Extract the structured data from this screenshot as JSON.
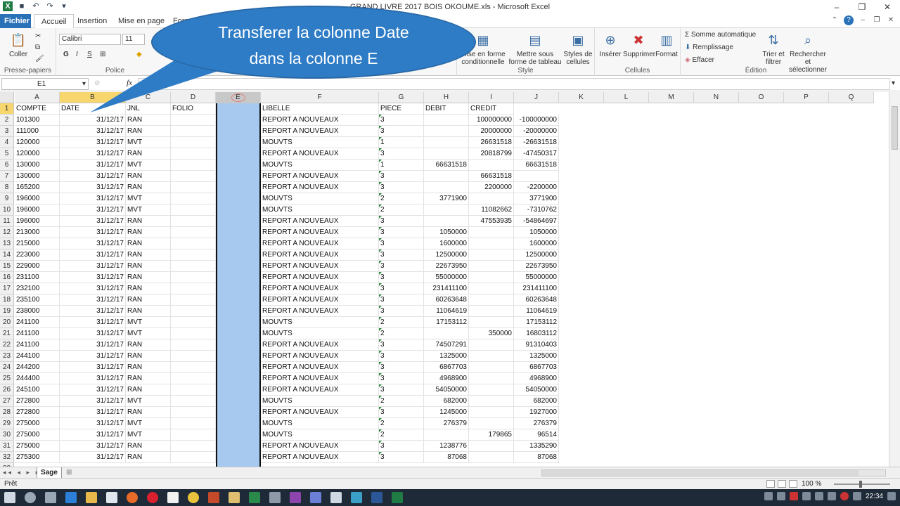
{
  "window": {
    "title": "GRAND LIVRE 2017 BOIS OKOUME.xls  -  Microsoft Excel"
  },
  "tabs": {
    "file": "Fichier",
    "home": "Accueil",
    "insert": "Insertion",
    "page_layout": "Mise en page",
    "formulas": "Form"
  },
  "ribbon": {
    "clipboard": {
      "paste": "Coller",
      "group": "Presse-papiers"
    },
    "font": {
      "name": "Calibri",
      "size": "11",
      "group": "Police"
    },
    "styles": {
      "cond": "Mise en forme conditionnelle",
      "table": "Mettre sous forme de tableau",
      "cell_styles": "Styles de cellules",
      "group": "Style"
    },
    "cells": {
      "insert": "Insérer",
      "delete": "Supprimer",
      "format": "Format",
      "group": "Cellules"
    },
    "editing": {
      "autosum": "Somme automatique",
      "fill": "Remplissage",
      "clear": "Effacer",
      "sort": "Trier et filtrer",
      "find": "Rechercher et sélectionner",
      "group": "Édition"
    }
  },
  "callout": {
    "line1": "Transferer la colonne Date",
    "line2": "dans la colonne E"
  },
  "formula_bar": {
    "name_box": "E1",
    "fx": "fx",
    "formula": ""
  },
  "grid": {
    "columns": [
      "A",
      "B",
      "C",
      "D",
      "E",
      "F",
      "G",
      "H",
      "I",
      "J",
      "K",
      "L",
      "M",
      "N",
      "O",
      "P",
      "Q"
    ],
    "headers": {
      "A": "COMPTE",
      "B": "DATE",
      "C": "JNL",
      "D": "FOLIO",
      "E": "",
      "F": "LIBELLE",
      "G": "PIECE",
      "H": "DEBIT",
      "I": "CREDIT",
      "J": ""
    },
    "rows": [
      [
        "101300",
        "31/12/17",
        "RAN",
        "REPORT A NOUVEAUX",
        "3",
        "",
        "100000000",
        "-100000000"
      ],
      [
        "111000",
        "31/12/17",
        "RAN",
        "REPORT A NOUVEAUX",
        "3",
        "",
        "20000000",
        "-20000000"
      ],
      [
        "120000",
        "31/12/17",
        "MVT",
        "MOUVTS",
        "1",
        "",
        "26631518",
        "-26631518"
      ],
      [
        "120000",
        "31/12/17",
        "RAN",
        "REPORT A NOUVEAUX",
        "3",
        "",
        "20818799",
        "-47450317"
      ],
      [
        "130000",
        "31/12/17",
        "MVT",
        "MOUVTS",
        "1",
        "66631518",
        "",
        "66631518"
      ],
      [
        "130000",
        "31/12/17",
        "RAN",
        "REPORT A NOUVEAUX",
        "3",
        "",
        "66631518",
        ""
      ],
      [
        "165200",
        "31/12/17",
        "RAN",
        "REPORT A NOUVEAUX",
        "3",
        "",
        "2200000",
        "-2200000"
      ],
      [
        "196000",
        "31/12/17",
        "MVT",
        "MOUVTS",
        "2",
        "3771900",
        "",
        "3771900"
      ],
      [
        "196000",
        "31/12/17",
        "MVT",
        "MOUVTS",
        "2",
        "",
        "11082662",
        "-7310762"
      ],
      [
        "196000",
        "31/12/17",
        "RAN",
        "REPORT A NOUVEAUX",
        "3",
        "",
        "47553935",
        "-54864697"
      ],
      [
        "213000",
        "31/12/17",
        "RAN",
        "REPORT A NOUVEAUX",
        "3",
        "1050000",
        "",
        "1050000"
      ],
      [
        "215000",
        "31/12/17",
        "RAN",
        "REPORT A NOUVEAUX",
        "3",
        "1600000",
        "",
        "1600000"
      ],
      [
        "223000",
        "31/12/17",
        "RAN",
        "REPORT A NOUVEAUX",
        "3",
        "12500000",
        "",
        "12500000"
      ],
      [
        "229000",
        "31/12/17",
        "RAN",
        "REPORT A NOUVEAUX",
        "3",
        "22673950",
        "",
        "22673950"
      ],
      [
        "231100",
        "31/12/17",
        "RAN",
        "REPORT A NOUVEAUX",
        "3",
        "55000000",
        "",
        "55000000"
      ],
      [
        "232100",
        "31/12/17",
        "RAN",
        "REPORT A NOUVEAUX",
        "3",
        "231411100",
        "",
        "231411100"
      ],
      [
        "235100",
        "31/12/17",
        "RAN",
        "REPORT A NOUVEAUX",
        "3",
        "60263648",
        "",
        "60263648"
      ],
      [
        "238000",
        "31/12/17",
        "RAN",
        "REPORT A NOUVEAUX",
        "3",
        "11064619",
        "",
        "11064619"
      ],
      [
        "241100",
        "31/12/17",
        "MVT",
        "MOUVTS",
        "2",
        "17153112",
        "",
        "17153112"
      ],
      [
        "241100",
        "31/12/17",
        "MVT",
        "MOUVTS",
        "2",
        "",
        "350000",
        "16803112"
      ],
      [
        "241100",
        "31/12/17",
        "RAN",
        "REPORT A NOUVEAUX",
        "3",
        "74507291",
        "",
        "91310403"
      ],
      [
        "244100",
        "31/12/17",
        "RAN",
        "REPORT A NOUVEAUX",
        "3",
        "1325000",
        "",
        "1325000"
      ],
      [
        "244200",
        "31/12/17",
        "RAN",
        "REPORT A NOUVEAUX",
        "3",
        "6867703",
        "",
        "6867703"
      ],
      [
        "244400",
        "31/12/17",
        "RAN",
        "REPORT A NOUVEAUX",
        "3",
        "4968900",
        "",
        "4968900"
      ],
      [
        "245100",
        "31/12/17",
        "RAN",
        "REPORT A NOUVEAUX",
        "3",
        "54050000",
        "",
        "54050000"
      ],
      [
        "272800",
        "31/12/17",
        "MVT",
        "MOUVTS",
        "2",
        "682000",
        "",
        "682000"
      ],
      [
        "272800",
        "31/12/17",
        "RAN",
        "REPORT A NOUVEAUX",
        "3",
        "1245000",
        "",
        "1927000"
      ],
      [
        "275000",
        "31/12/17",
        "MVT",
        "MOUVTS",
        "2",
        "276379",
        "",
        "276379"
      ],
      [
        "275000",
        "31/12/17",
        "MVT",
        "MOUVTS",
        "2",
        "",
        "179865",
        "96514"
      ],
      [
        "275000",
        "31/12/17",
        "RAN",
        "REPORT A NOUVEAUX",
        "3",
        "1238776",
        "",
        "1335290"
      ],
      [
        "275300",
        "31/12/17",
        "RAN",
        "REPORT A NOUVEAUX",
        "3",
        "87068",
        "",
        "87068"
      ]
    ]
  },
  "sheets": {
    "active": "Sage"
  },
  "status": {
    "ready": "Prêt",
    "zoom": "100 %"
  },
  "taskbar": {
    "clock": "22:34"
  },
  "colors": {
    "file_tab": "#2a72b8",
    "callout": "#2e7cc6",
    "selection": "#a7c9ef",
    "header_highlight": "#f7d66e"
  }
}
